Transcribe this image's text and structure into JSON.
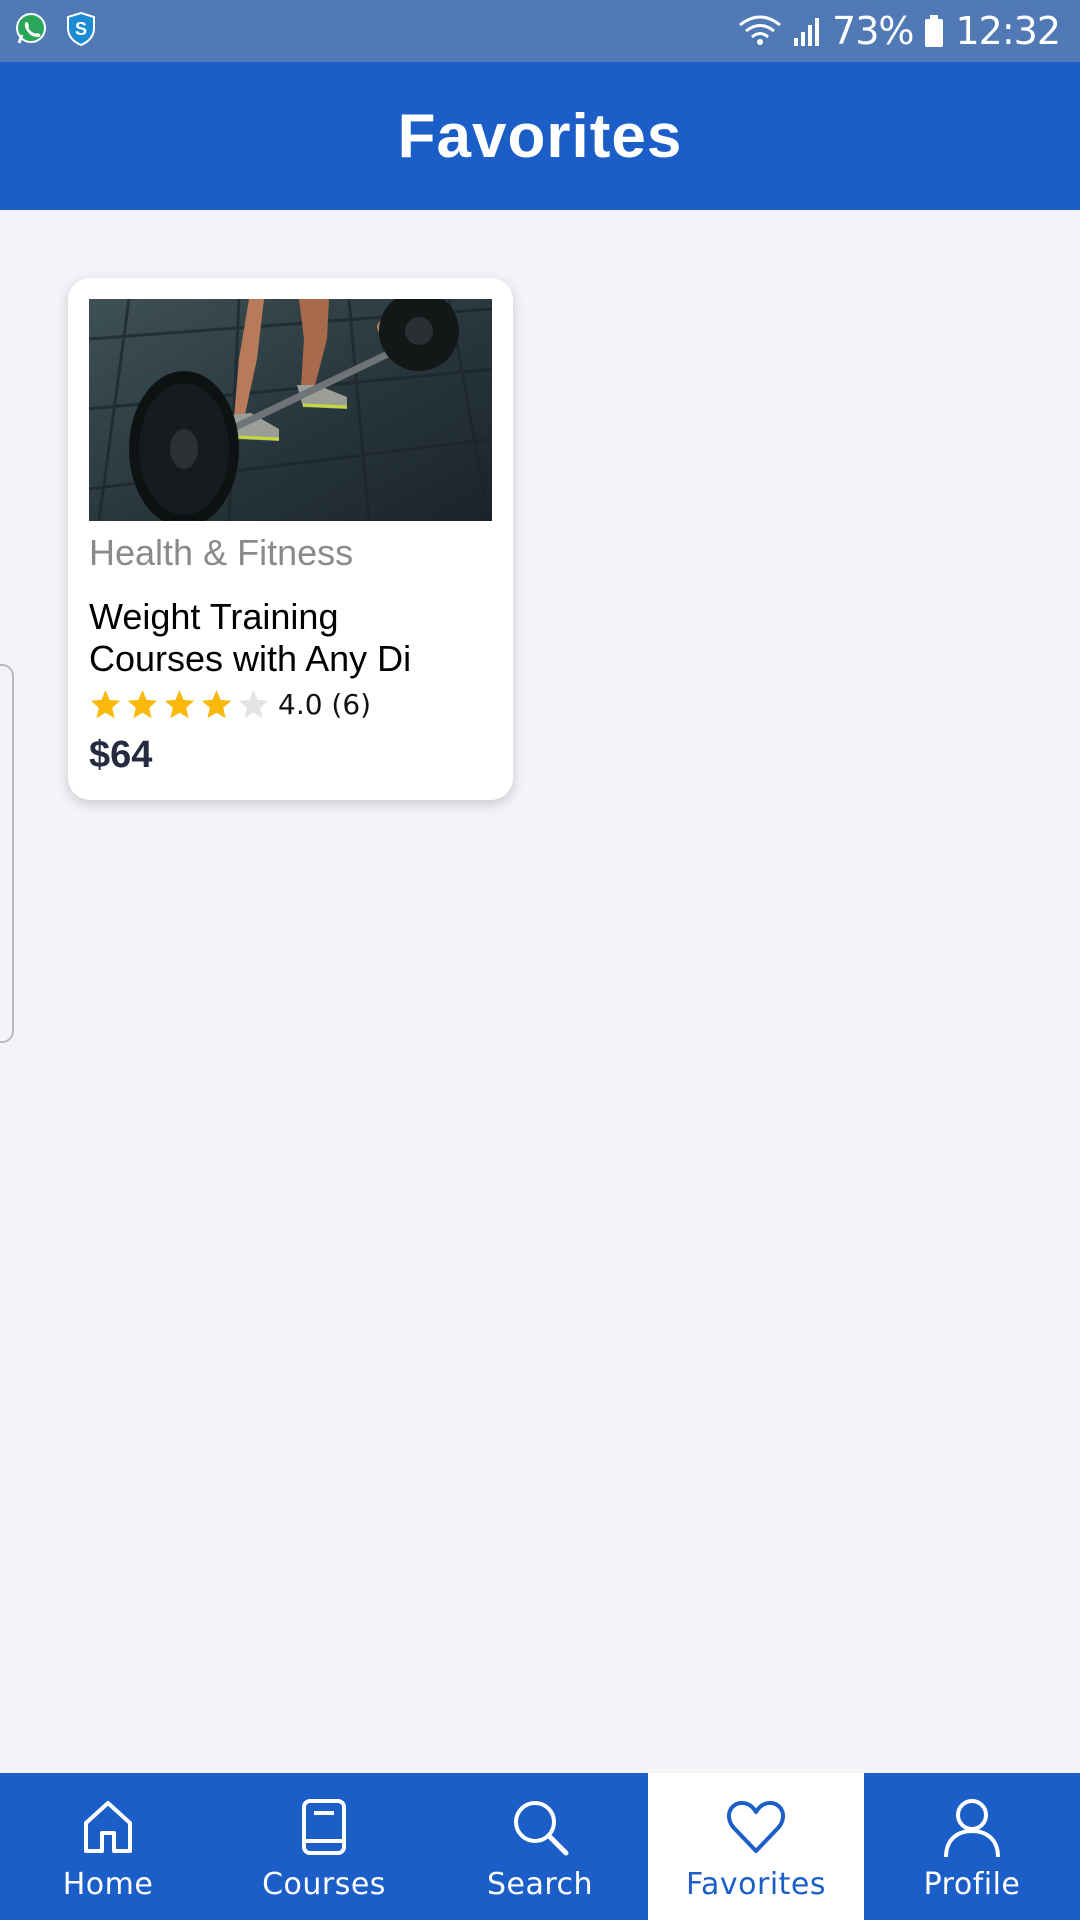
{
  "status_bar": {
    "battery": "73%",
    "time": "12:32",
    "app_icons": [
      "whatsapp-icon",
      "shield-s-icon"
    ],
    "system_icons": [
      "wifi-icon",
      "signal-icon",
      "battery-icon"
    ]
  },
  "header": {
    "title": "Favorites"
  },
  "favorites": [
    {
      "category": "Health & Fitness",
      "title_line1": "Weight Training",
      "title_line2": "Courses with Any Di",
      "rating_text": "4.0 (6)",
      "rating_value": 4.0,
      "rating_max": 5,
      "price": "$64",
      "image": "barbell-deadlift-photo"
    }
  ],
  "nav": {
    "items": [
      {
        "label": "Home",
        "icon": "home-icon"
      },
      {
        "label": "Courses",
        "icon": "book-icon"
      },
      {
        "label": "Search",
        "icon": "search-icon"
      },
      {
        "label": "Favorites",
        "icon": "heart-icon",
        "active": true
      },
      {
        "label": "Profile",
        "icon": "person-icon"
      }
    ]
  },
  "colors": {
    "primary": "#1b5ec8",
    "status_bar": "#5079b6",
    "background": "#f2f4f8",
    "star_filled": "#f8b90c",
    "star_empty": "#e4e4e4"
  }
}
